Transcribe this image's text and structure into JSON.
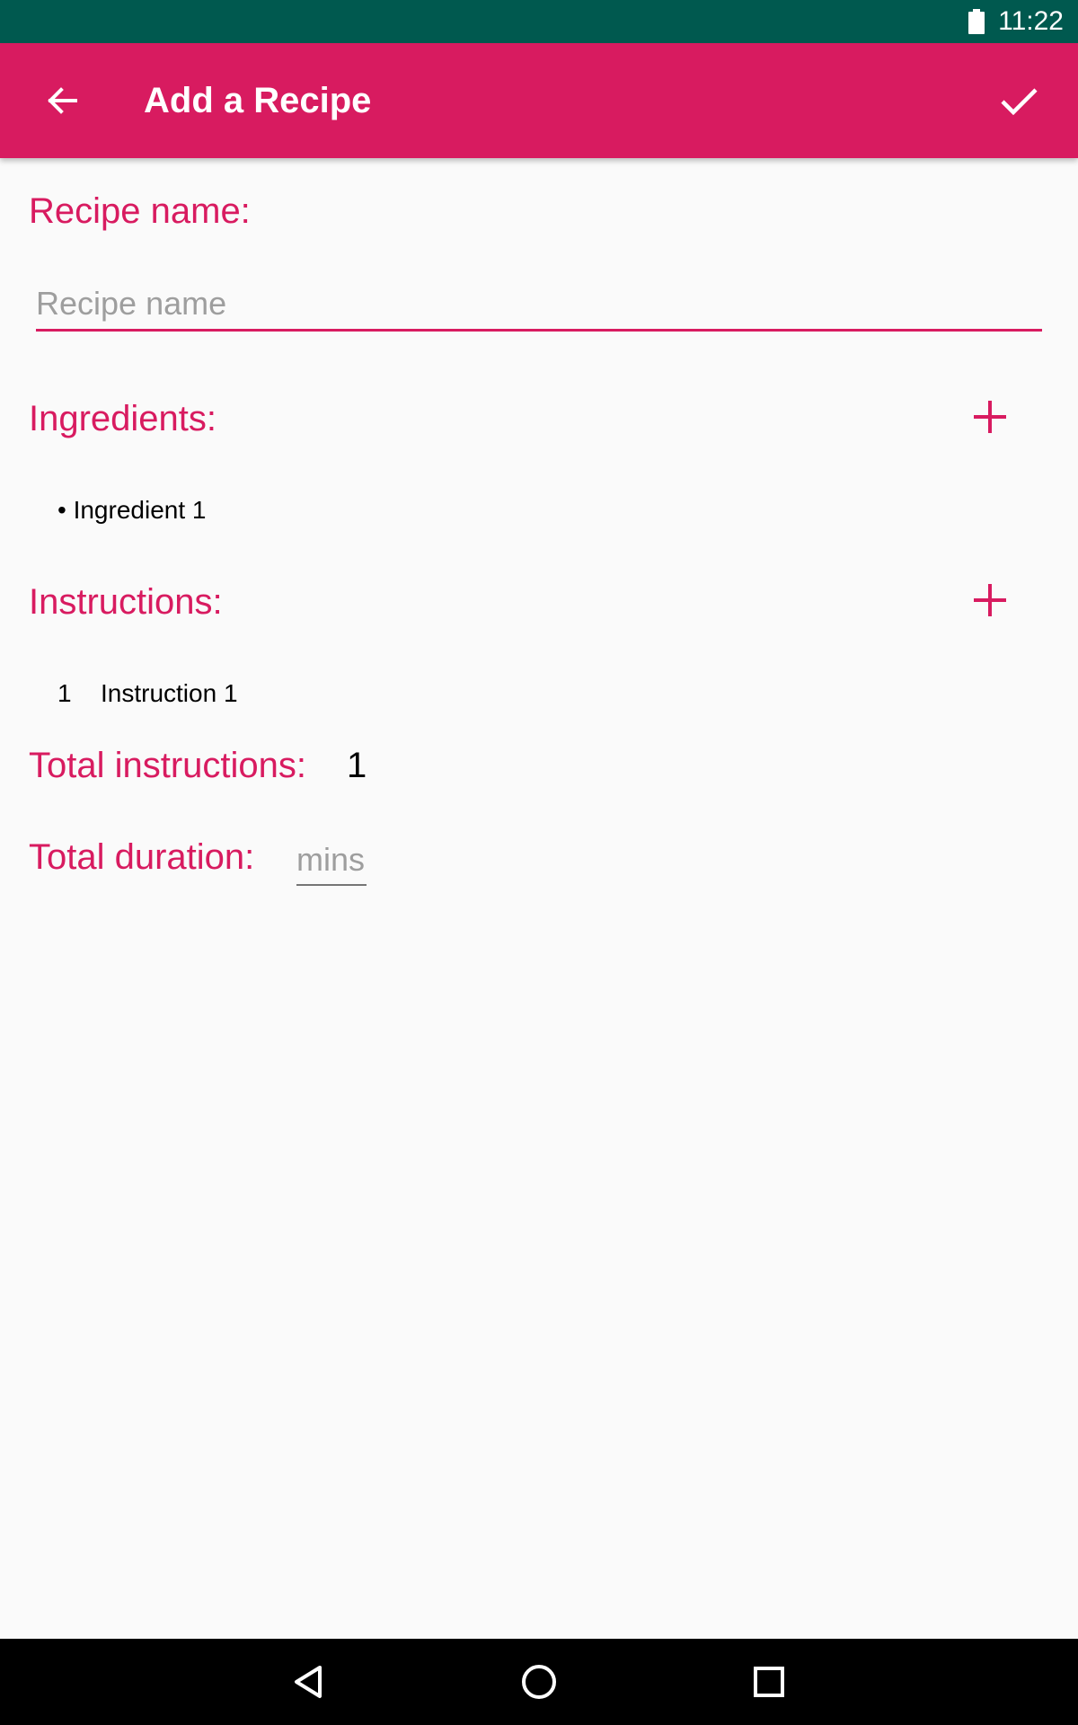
{
  "status_bar": {
    "time": "11:22",
    "battery_icon": "battery-full-icon"
  },
  "app_bar": {
    "title": "Add a Recipe",
    "back_icon": "arrow-back-icon",
    "confirm_icon": "check-icon",
    "background": "#D81B60"
  },
  "form": {
    "recipe_name": {
      "label": "Recipe name:",
      "value": "",
      "placeholder": "Recipe name"
    },
    "ingredients": {
      "label": "Ingredients:",
      "add_icon": "plus-icon",
      "items": [
        "• Ingredient 1"
      ]
    },
    "instructions": {
      "label": "Instructions:",
      "add_icon": "plus-icon",
      "items": [
        {
          "number": "1",
          "text": "Instruction 1"
        }
      ]
    },
    "total_instructions": {
      "label": "Total instructions:",
      "value": "1"
    },
    "total_duration": {
      "label": "Total duration:",
      "value": "",
      "placeholder": "mins"
    }
  },
  "nav_bar": {
    "back_icon": "nav-back-icon",
    "home_icon": "nav-home-icon",
    "recents_icon": "nav-recents-icon"
  },
  "colors": {
    "accent": "#D81B60",
    "status_bar": "#00594F",
    "background": "#FAFAFA"
  }
}
